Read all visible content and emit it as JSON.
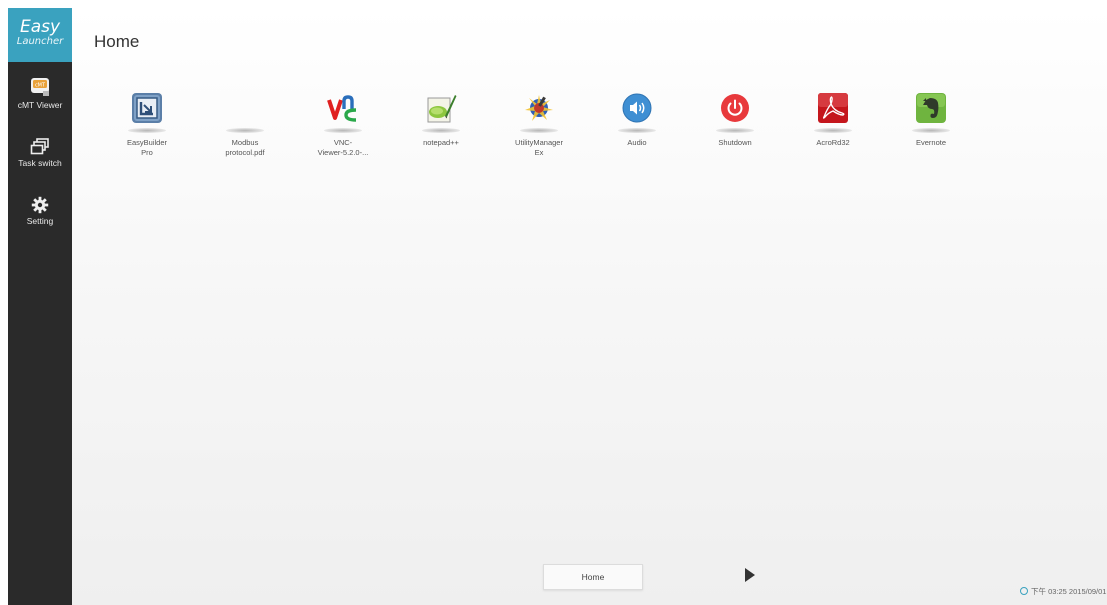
{
  "logo": {
    "line1": "Easy",
    "line2": "Launcher"
  },
  "sidebar": {
    "items": [
      {
        "label": "cMT Viewer",
        "icon": "cmt-viewer-icon"
      },
      {
        "label": "Task switch",
        "icon": "task-switch-icon"
      },
      {
        "label": "Setting",
        "icon": "gear-icon"
      }
    ]
  },
  "page": {
    "title": "Home"
  },
  "apps": [
    {
      "line1": "EasyBuilder",
      "line2": "Pro",
      "icon": "easybuilder-icon"
    },
    {
      "line1": "Modbus",
      "line2": "protocol.pdf",
      "icon": "blank-file-icon"
    },
    {
      "line1": "VNC-",
      "line2": "Viewer-5.2.0-...",
      "icon": "vnc-icon"
    },
    {
      "line1": "notepad++",
      "line2": "",
      "icon": "notepad-icon"
    },
    {
      "line1": "UtilityManager",
      "line2": "Ex",
      "icon": "utility-manager-icon"
    },
    {
      "line1": "Audio",
      "line2": "",
      "icon": "audio-icon"
    },
    {
      "line1": "Shutdown",
      "line2": "",
      "icon": "power-icon"
    },
    {
      "line1": "AcroRd32",
      "line2": "",
      "icon": "acrobat-icon"
    },
    {
      "line1": "Evernote",
      "line2": "",
      "icon": "evernote-icon"
    }
  ],
  "footer": {
    "page_button": "Home",
    "clock": "下午 03:25 2015/09/01"
  },
  "colors": {
    "accent": "#3aa2bf",
    "sidebar_bg": "#2a2a2a",
    "audio": "#3f8fd3",
    "shutdown": "#e8393c",
    "acrobat": "#c4161c",
    "evernote": "#6fb43f"
  }
}
